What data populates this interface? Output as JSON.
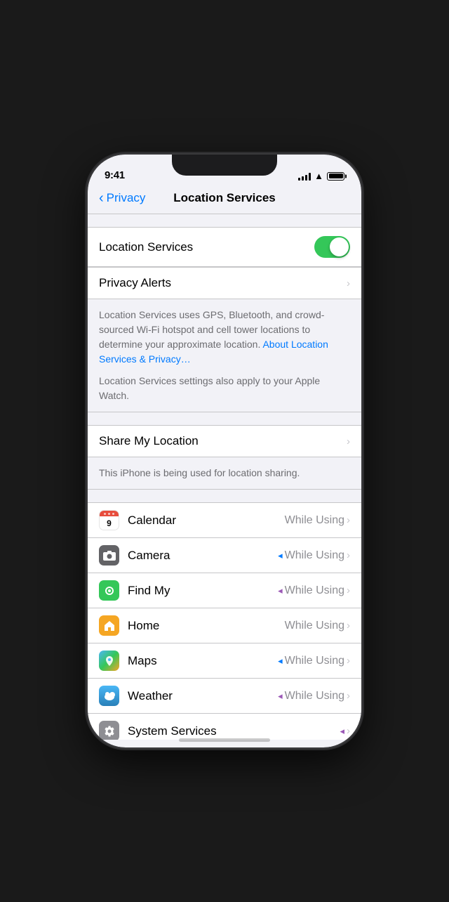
{
  "statusBar": {
    "time": "9:41"
  },
  "navBar": {
    "backLabel": "Privacy",
    "title": "Location Services"
  },
  "locationServices": {
    "label": "Location Services",
    "enabled": true
  },
  "privacyAlerts": {
    "label": "Privacy Alerts"
  },
  "description": {
    "text": "Location Services uses GPS, Bluetooth, and crowd-sourced Wi-Fi hotspot and cell tower locations to determine your approximate location.",
    "linkText": "About Location Services & Privacy…",
    "watchText": "Location Services settings also apply to your Apple Watch."
  },
  "shareMyLocation": {
    "label": "Share My Location",
    "sublabel": "This iPhone is being used for location sharing."
  },
  "apps": [
    {
      "name": "Calendar",
      "status": "While Using",
      "hasArrow": false,
      "arrowColor": "none",
      "iconType": "calendar"
    },
    {
      "name": "Camera",
      "status": "While Using",
      "hasArrow": true,
      "arrowColor": "blue",
      "iconType": "camera"
    },
    {
      "name": "Find My",
      "status": "While Using",
      "hasArrow": true,
      "arrowColor": "purple",
      "iconType": "findmy"
    },
    {
      "name": "Home",
      "status": "While Using",
      "hasArrow": false,
      "arrowColor": "none",
      "iconType": "home"
    },
    {
      "name": "Maps",
      "status": "While Using",
      "hasArrow": true,
      "arrowColor": "blue",
      "iconType": "maps"
    },
    {
      "name": "Weather",
      "status": "While Using",
      "hasArrow": true,
      "arrowColor": "purple",
      "iconType": "weather"
    },
    {
      "name": "System Services",
      "status": "",
      "hasArrow": true,
      "arrowColor": "purple",
      "iconType": "system"
    }
  ]
}
